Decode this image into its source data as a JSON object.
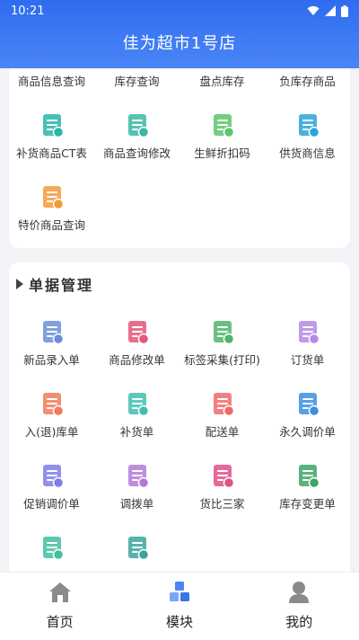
{
  "status": {
    "time": "10:21"
  },
  "header": {
    "title": "佳为超市1号店"
  },
  "card1": {
    "items": [
      {
        "label": "商品信息查询",
        "icon": "product-info-icon",
        "color": "#4a7cf3"
      },
      {
        "label": "库存查询",
        "icon": "stock-query-icon",
        "color": "#f08a4b"
      },
      {
        "label": "盘点库存",
        "icon": "inventory-count-icon",
        "color": "#3dbb7a"
      },
      {
        "label": "负库存商品",
        "icon": "negative-stock-icon",
        "color": "#a36ef0"
      },
      {
        "label": "补货商品CT表",
        "icon": "replenish-ct-icon",
        "color": "#28b6a8"
      },
      {
        "label": "商品查询修改",
        "icon": "product-edit-icon",
        "color": "#3bb7a4"
      },
      {
        "label": "生鲜折扣码",
        "icon": "fresh-discount-icon",
        "color": "#5cc66b"
      },
      {
        "label": "供货商信息",
        "icon": "supplier-icon",
        "color": "#2aa3d6"
      },
      {
        "label": "特价商品查询",
        "icon": "special-price-icon",
        "color": "#f59a3a"
      }
    ]
  },
  "card2": {
    "title": "单据管理",
    "items": [
      {
        "label": "新品录入单",
        "icon": "new-product-icon",
        "color": "#6b8fd6"
      },
      {
        "label": "商品修改单",
        "icon": "product-modify-icon",
        "color": "#e4557a"
      },
      {
        "label": "标签采集(打印)",
        "icon": "label-print-icon",
        "color": "#4fb56d"
      },
      {
        "label": "订货单",
        "icon": "order-icon",
        "color": "#b48ae8"
      },
      {
        "label": "入(退)库单",
        "icon": "stock-in-icon",
        "color": "#f07a5a"
      },
      {
        "label": "补货单",
        "icon": "replenish-icon",
        "color": "#3fc0b0"
      },
      {
        "label": "配送单",
        "icon": "delivery-icon",
        "color": "#f06a6a"
      },
      {
        "label": "永久调价单",
        "icon": "price-adjust-icon",
        "color": "#3a8fe0"
      },
      {
        "label": "促销调价单",
        "icon": "promo-price-icon",
        "color": "#7b7ee8"
      },
      {
        "label": "调拨单",
        "icon": "transfer-icon",
        "color": "#b07ad8"
      },
      {
        "label": "货比三家",
        "icon": "compare-icon",
        "color": "#e0508a"
      },
      {
        "label": "库存变更单",
        "icon": "stock-change-icon",
        "color": "#3fa36a"
      },
      {
        "label": "",
        "icon": "item-13-icon",
        "color": "#3fc0a0"
      },
      {
        "label": "",
        "icon": "item-14-icon",
        "color": "#3aa59a"
      }
    ]
  },
  "tabbar": {
    "tabs": [
      {
        "label": "首页",
        "icon": "home-icon"
      },
      {
        "label": "模块",
        "icon": "modules-icon"
      },
      {
        "label": "我的",
        "icon": "profile-icon"
      }
    ]
  }
}
